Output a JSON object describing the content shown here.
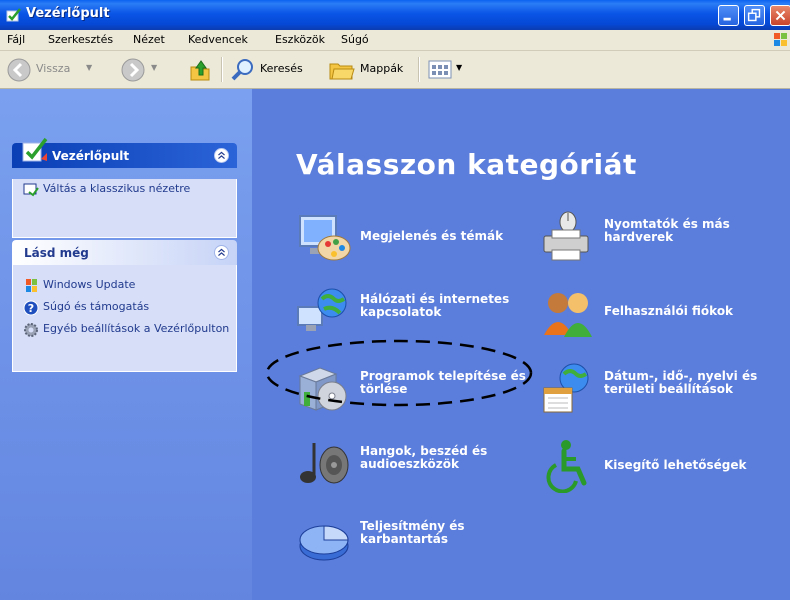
{
  "window": {
    "title": "Vezérlőpult"
  },
  "menu": [
    "Fájl",
    "Szerkesztés",
    "Nézet",
    "Kedvencek",
    "Eszközök",
    "Súgó"
  ],
  "toolbar": {
    "back_label": "Vissza",
    "search_label": "Keresés",
    "folders_label": "Mappák"
  },
  "left_panels": {
    "control_panel": {
      "title": "Vezérlőpult",
      "link": "Váltás a klasszikus nézetre"
    },
    "see_also": {
      "title": "Lásd még",
      "links": [
        "Windows Update",
        "Súgó és támogatás",
        "Egyéb beállítások a Vezérlőpulton"
      ]
    }
  },
  "main": {
    "heading": "Válasszon kategóriát",
    "categories": [
      "Megjelenés és témák",
      "Nyomtatók és más hardverek",
      "Hálózati és internetes kapcsolatok",
      "Felhasználói fiókok",
      "Programok telepítése és törlése",
      "Dátum-, idő-, nyelvi és területi beállítások",
      "Hangok, beszéd és audioeszközök",
      "Kisegítő lehetőségek",
      "Teljesítmény és karbantartás"
    ]
  },
  "colors": {
    "titlebar": "#0548d6",
    "pane": "#5b7ddb",
    "taskpane": "#6a8ee6"
  }
}
